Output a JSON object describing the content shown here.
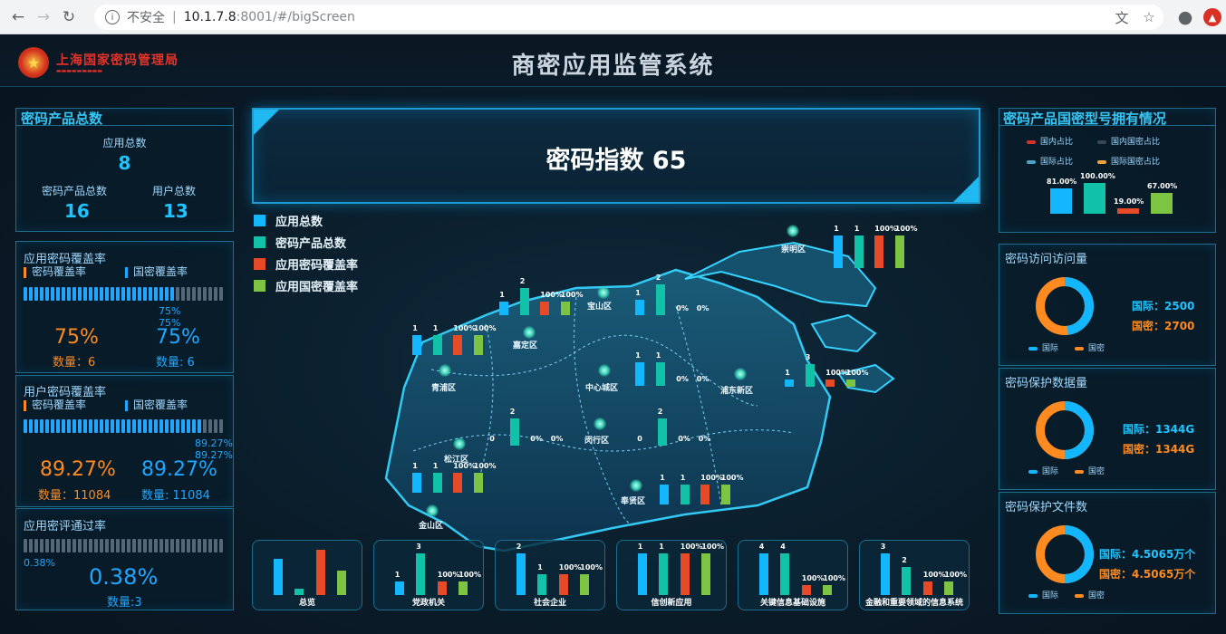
{
  "browser": {
    "insecure": "不安全",
    "host": "10.1.7.8",
    "path": ":8001/#/bigScreen"
  },
  "header": {
    "org_name": "上海国家密码管理局",
    "title": "商密应用监管系统"
  },
  "left": {
    "totals": {
      "title": "密码产品总数",
      "app_total_label": "应用总数",
      "app_total": "8",
      "product_total_label": "密码产品总数",
      "product_total": "16",
      "user_total_label": "用户总数",
      "user_total": "13"
    },
    "app_coverage": {
      "title": "应用密码覆盖率",
      "legend_a": "密码覆盖率",
      "legend_b": "国密覆盖率",
      "fill_a": 0.75,
      "fill_b": 0.75,
      "tip_a": "75%",
      "tip_b": "75%",
      "pct_a": "75%",
      "pct_b": "75%",
      "count_a": "数量：6",
      "count_b": "数量: 6"
    },
    "user_coverage": {
      "title": "用户密码覆盖率",
      "legend_a": "密码覆盖率",
      "legend_b": "国密覆盖率",
      "fill_a": 0.8927,
      "fill_b": 0.8927,
      "tip_a": "89.27%",
      "tip_b": "89.27%",
      "pct_a": "89.27%",
      "pct_b": "89.27%",
      "count_a": "数量：11084",
      "count_b": "数量: 11084"
    },
    "pass_rate": {
      "title": "应用密评通过率",
      "fill": 0.0038,
      "tip": "0.38%",
      "pct": "0.38%",
      "count": "数量:3"
    }
  },
  "center": {
    "index_label": "密码指数 65",
    "legend": [
      "应用总数",
      "密码产品总数",
      "应用密码覆盖率",
      "应用国密覆盖率"
    ],
    "colors": {
      "a": "#13b7ff",
      "b": "#12c2a8",
      "c": "#e64a26",
      "d": "#7cc441"
    },
    "districts": [
      {
        "name": "崇明区",
        "values": [
          "1",
          "1",
          "100%",
          "100%"
        ],
        "heights": [
          1,
          1,
          1,
          1
        ]
      },
      {
        "name": "宝山区",
        "values": [
          "1",
          "2",
          "0%",
          "0%"
        ],
        "heights": [
          0.5,
          1,
          0,
          0
        ]
      },
      {
        "name": "嘉定区",
        "values": [
          "1",
          "2",
          "100%",
          "100%"
        ],
        "heights": [
          0.5,
          1,
          0.5,
          0.5
        ]
      },
      {
        "name": "青浦区",
        "values": [
          "1",
          "1",
          "100%",
          "100%"
        ],
        "heights": [
          1,
          1,
          1,
          1
        ]
      },
      {
        "name": "中心城区",
        "values": [
          "1",
          "1",
          "0%",
          "0%"
        ],
        "heights": [
          1,
          1,
          0,
          0
        ]
      },
      {
        "name": "浦东新区",
        "values": [
          "1",
          "3",
          "100%",
          "100%"
        ],
        "heights": [
          0.33,
          1,
          0.33,
          0.33
        ]
      },
      {
        "name": "松江区",
        "values": [
          "0",
          "2",
          "0%",
          "0%"
        ],
        "heights": [
          0,
          1,
          0,
          0
        ]
      },
      {
        "name": "闵行区",
        "values": [
          "0",
          "2",
          "0%",
          "0%"
        ],
        "heights": [
          0,
          1,
          0,
          0
        ]
      },
      {
        "name": "金山区",
        "values": [
          "1",
          "1",
          "100%",
          "100%"
        ],
        "heights": [
          1,
          1,
          1,
          1
        ]
      },
      {
        "name": "奉贤区",
        "values": [
          "1",
          "1",
          "100%",
          "100%"
        ],
        "heights": [
          1,
          1,
          1,
          1
        ]
      }
    ],
    "cards": [
      {
        "caption": "总览",
        "values": [
          "",
          "",
          "",
          ""
        ],
        "heights": [
          0.8,
          0.15,
          1,
          0.55
        ]
      },
      {
        "caption": "党政机关",
        "values": [
          "1",
          "3",
          "100%",
          "100%"
        ],
        "heights": [
          0.33,
          1,
          0.33,
          0.33
        ]
      },
      {
        "caption": "社会企业",
        "values": [
          "2",
          "1",
          "100%",
          "100%"
        ],
        "heights": [
          1,
          0.5,
          0.5,
          0.5
        ]
      },
      {
        "caption": "信创新应用",
        "values": [
          "1",
          "1",
          "100%",
          "100%"
        ],
        "heights": [
          1,
          1,
          1,
          1
        ]
      },
      {
        "caption": "关键信息基础设施",
        "values": [
          "4",
          "4",
          "100%",
          "100%"
        ],
        "heights": [
          1,
          1,
          0.25,
          0.25
        ]
      },
      {
        "caption": "金融和重要领域的信息系统",
        "values": [
          "3",
          "2",
          "100%",
          "100%"
        ],
        "heights": [
          1,
          0.67,
          0.33,
          0.33
        ]
      }
    ]
  },
  "right": {
    "model": {
      "title": "密码产品国密型号拥有情况",
      "legend": [
        "国内占比",
        "国内国密占比",
        "国际占比",
        "国际国密占比"
      ],
      "legend_colors": [
        "#d9322a",
        "#3a4654",
        "#4aa3c8",
        "#f0a23b"
      ],
      "values": [
        "81.00%",
        "100.00%",
        "19.00%",
        "67.00%"
      ],
      "fractions": [
        0.81,
        1.0,
        0.19,
        0.67
      ],
      "bar_colors": [
        "#13b7ff",
        "#12c2a8",
        "#e64a26",
        "#7cc441"
      ]
    },
    "visits": {
      "title": "密码访问访问量",
      "intl": "国际：2500",
      "gm": "国密：2700",
      "intl_share": 0.48,
      "legend_a": "国际",
      "legend_b": "国密"
    },
    "data_volume": {
      "title": "密码保护数据量",
      "intl": "国际：1344G",
      "gm": "国密：1344G",
      "intl_share": 0.5,
      "legend_a": "国际",
      "legend_b": "国密"
    },
    "files": {
      "title": "密码保护文件数",
      "intl": "国际：4.5065万个",
      "gm": "国密：4.5065万个",
      "intl_share": 0.5,
      "legend_a": "国际",
      "legend_b": "国密"
    }
  }
}
